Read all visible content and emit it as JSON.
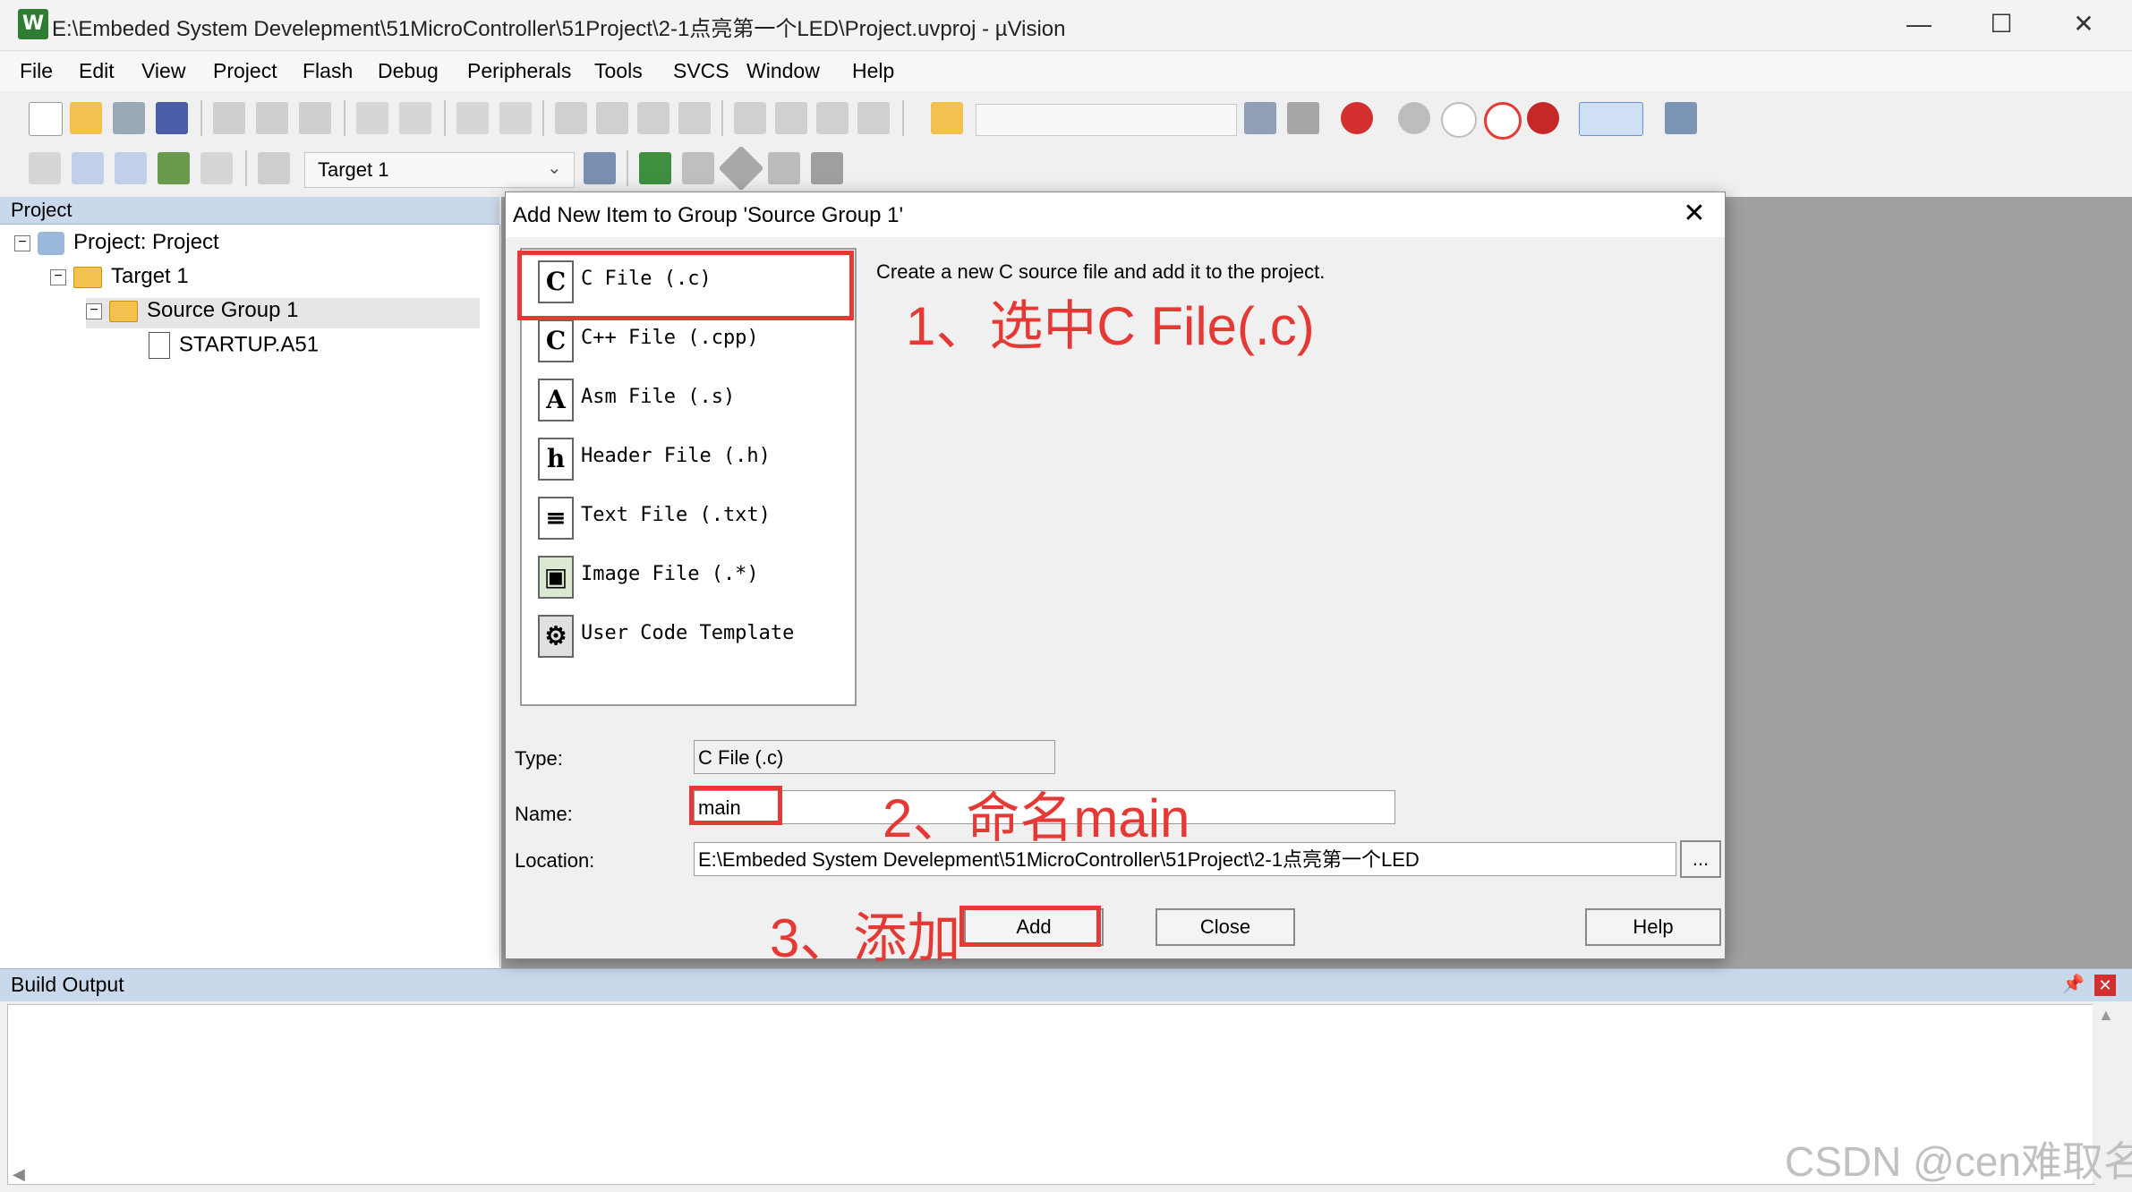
{
  "window": {
    "title": "E:\\Embeded System Develepment\\51MicroController\\51Project\\2-1点亮第一个LED\\Project.uvproj - µVision",
    "app_icon_letter": "W",
    "minimize": "—",
    "maximize": "☐",
    "close": "✕"
  },
  "menu": [
    "File",
    "Edit",
    "View",
    "Project",
    "Flash",
    "Debug",
    "Peripherals",
    "Tools",
    "SVCS",
    "Window",
    "Help"
  ],
  "toolbar2": {
    "target": "Target 1"
  },
  "project_panel": {
    "header": "Project",
    "tree": {
      "root": "Project: Project",
      "target": "Target 1",
      "group": "Source Group 1",
      "file": "STARTUP.A51"
    }
  },
  "build_output": {
    "header": "Build Output"
  },
  "dialog": {
    "title": "Add New Item to Group 'Source Group 1'",
    "close": "✕",
    "description": "Create a new C source file and add it to the project.",
    "items": [
      {
        "icon": "C",
        "label": "C File (.c)"
      },
      {
        "icon": "C",
        "label": "C++ File (.cpp)"
      },
      {
        "icon": "A",
        "label": "Asm File (.s)"
      },
      {
        "icon": "h",
        "label": "Header File (.h)"
      },
      {
        "icon": "≡",
        "label": "Text File (.txt)"
      },
      {
        "icon": "▣",
        "label": "Image File (.*)"
      },
      {
        "icon": "⚙",
        "label": "User Code Template"
      }
    ],
    "type_label": "Type:",
    "type_value": "C File (.c)",
    "name_label": "Name:",
    "name_value": "main",
    "location_label": "Location:",
    "location_value": "E:\\Embeded System Develepment\\51MicroController\\51Project\\2-1点亮第一个LED",
    "browse": "...",
    "add": "Add",
    "close_btn": "Close",
    "help": "Help"
  },
  "annotations": {
    "step1": "1、选中C File(.c)",
    "step2": "2、命名main",
    "step3": "3、添加"
  },
  "watermark": "CSDN @cen难取名",
  "colors": {
    "annotation": "#e53935",
    "panel_header": "#c9d8ea"
  }
}
